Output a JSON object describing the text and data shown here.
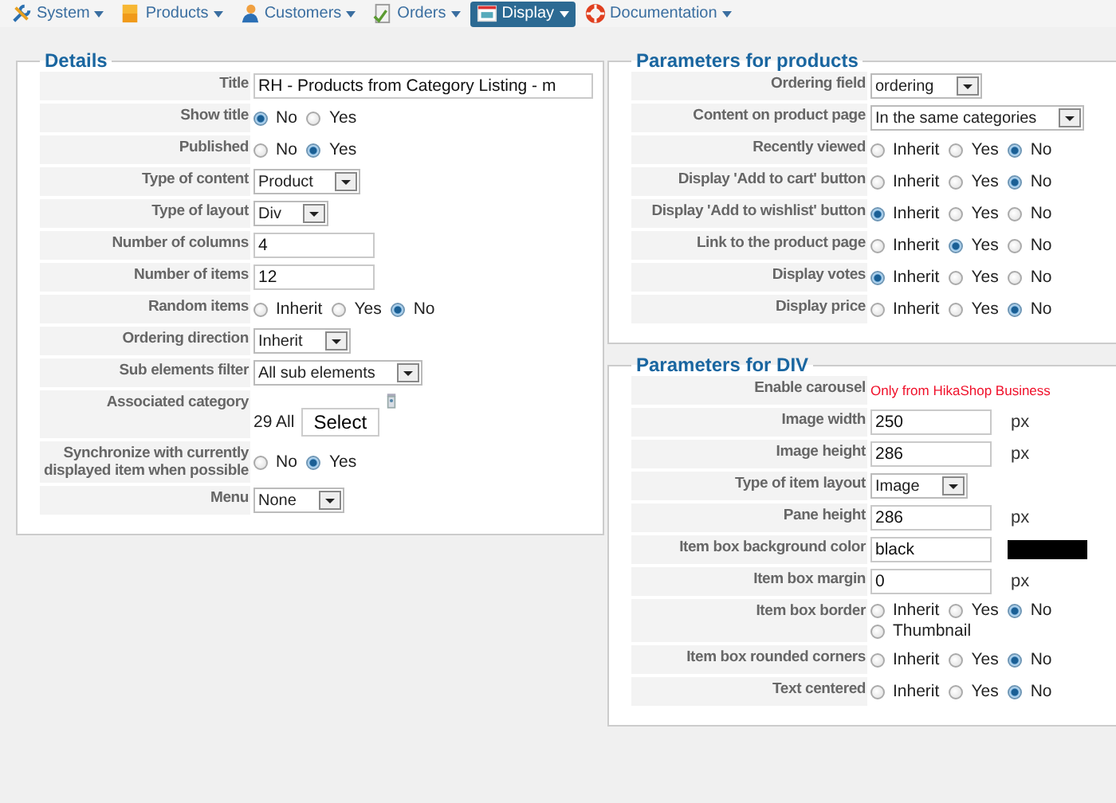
{
  "menu": [
    {
      "label": "System",
      "kind": "wrench",
      "selected": false
    },
    {
      "label": "Products",
      "kind": "boxes",
      "selected": false
    },
    {
      "label": "Customers",
      "kind": "person",
      "selected": false
    },
    {
      "label": "Orders",
      "kind": "document",
      "selected": false
    },
    {
      "label": "Display",
      "kind": "window",
      "selected": true
    },
    {
      "label": "Documentation",
      "kind": "lifebuoy",
      "selected": false
    }
  ],
  "details": {
    "legend": "Details",
    "rows": [
      {
        "label": "Title",
        "kind": "text",
        "value": "RH - Products from Category Listing - m"
      },
      {
        "label": "Show title",
        "kind": "radio",
        "options": [
          {
            "label": "No",
            "selected": true
          },
          {
            "label": "Yes",
            "selected": false
          }
        ]
      },
      {
        "label": "Published",
        "kind": "radio",
        "options": [
          {
            "label": "No",
            "selected": false
          },
          {
            "label": "Yes",
            "selected": true
          }
        ]
      },
      {
        "label": "Type of content",
        "kind": "select",
        "value": "Product"
      },
      {
        "label": "Type of layout",
        "kind": "select",
        "value": "Div"
      },
      {
        "label": "Number of columns",
        "kind": "text",
        "value": "4"
      },
      {
        "label": "Number of items",
        "kind": "text",
        "value": "12"
      },
      {
        "label": "Random items",
        "kind": "radio",
        "options": [
          {
            "label": "Inherit",
            "selected": false
          },
          {
            "label": "Yes",
            "selected": false
          },
          {
            "label": "No",
            "selected": true
          }
        ]
      },
      {
        "label": "Ordering direction",
        "kind": "select",
        "value": "Inherit"
      },
      {
        "label": "Sub elements filter",
        "kind": "select",
        "value": "All sub elements"
      },
      {
        "label": "Associated category",
        "kind": "category",
        "value": "29 All",
        "button": "Select"
      },
      {
        "label": "Synchronize with currently displayed item when possible",
        "kind": "radio",
        "options": [
          {
            "label": "No",
            "selected": false
          },
          {
            "label": "Yes",
            "selected": true
          }
        ]
      },
      {
        "label": "Menu",
        "kind": "select",
        "value": "None"
      }
    ]
  },
  "products_params": {
    "legend": "Parameters for products",
    "rows": [
      {
        "label": "Ordering field",
        "kind": "select",
        "value": "ordering"
      },
      {
        "label": "Content on product page",
        "kind": "select",
        "value": "In the same categories"
      },
      {
        "label": "Recently viewed",
        "kind": "radio",
        "options": [
          {
            "label": "Inherit",
            "selected": false
          },
          {
            "label": "Yes",
            "selected": false
          },
          {
            "label": "No",
            "selected": true
          }
        ]
      },
      {
        "label": "Display 'Add to cart' button",
        "kind": "radio",
        "options": [
          {
            "label": "Inherit",
            "selected": false
          },
          {
            "label": "Yes",
            "selected": false
          },
          {
            "label": "No",
            "selected": true
          }
        ]
      },
      {
        "label": "Display 'Add to wishlist' button",
        "kind": "radio",
        "options": [
          {
            "label": "Inherit",
            "selected": true
          },
          {
            "label": "Yes",
            "selected": false
          },
          {
            "label": "No",
            "selected": false
          }
        ]
      },
      {
        "label": "Link to the product page",
        "kind": "radio",
        "options": [
          {
            "label": "Inherit",
            "selected": false
          },
          {
            "label": "Yes",
            "selected": true
          },
          {
            "label": "No",
            "selected": false
          }
        ]
      },
      {
        "label": "Display votes",
        "kind": "radio",
        "options": [
          {
            "label": "Inherit",
            "selected": true
          },
          {
            "label": "Yes",
            "selected": false
          },
          {
            "label": "No",
            "selected": false
          }
        ]
      },
      {
        "label": "Display price",
        "kind": "radio",
        "options": [
          {
            "label": "Inherit",
            "selected": false
          },
          {
            "label": "Yes",
            "selected": false
          },
          {
            "label": "No",
            "selected": true
          }
        ]
      }
    ]
  },
  "div_params": {
    "legend": "Parameters for DIV",
    "rows": [
      {
        "label": "Enable carousel",
        "kind": "note",
        "value": "Only from HikaShop Business"
      },
      {
        "label": "Image width",
        "kind": "text",
        "value": "250",
        "unit": "px"
      },
      {
        "label": "Image height",
        "kind": "text",
        "value": "286",
        "unit": "px"
      },
      {
        "label": "Type of item layout",
        "kind": "select",
        "value": "Image"
      },
      {
        "label": "Pane height",
        "kind": "text",
        "value": "286",
        "unit": "px"
      },
      {
        "label": "Item box background color",
        "kind": "color",
        "value": "black",
        "color": "#000000"
      },
      {
        "label": "Item box margin",
        "kind": "text",
        "value": "0",
        "unit": "px"
      },
      {
        "label": "Item box border",
        "kind": "radio",
        "options": [
          {
            "label": "Inherit",
            "selected": false
          },
          {
            "label": "Yes",
            "selected": false
          },
          {
            "label": "No",
            "selected": true
          },
          {
            "label": "Thumbnail",
            "selected": false
          }
        ]
      },
      {
        "label": "Item box rounded corners",
        "kind": "radio",
        "options": [
          {
            "label": "Inherit",
            "selected": false
          },
          {
            "label": "Yes",
            "selected": false
          },
          {
            "label": "No",
            "selected": true
          }
        ]
      },
      {
        "label": "Text centered",
        "kind": "radio",
        "options": [
          {
            "label": "Inherit",
            "selected": false
          },
          {
            "label": "Yes",
            "selected": false
          },
          {
            "label": "No",
            "selected": true
          }
        ]
      }
    ]
  }
}
